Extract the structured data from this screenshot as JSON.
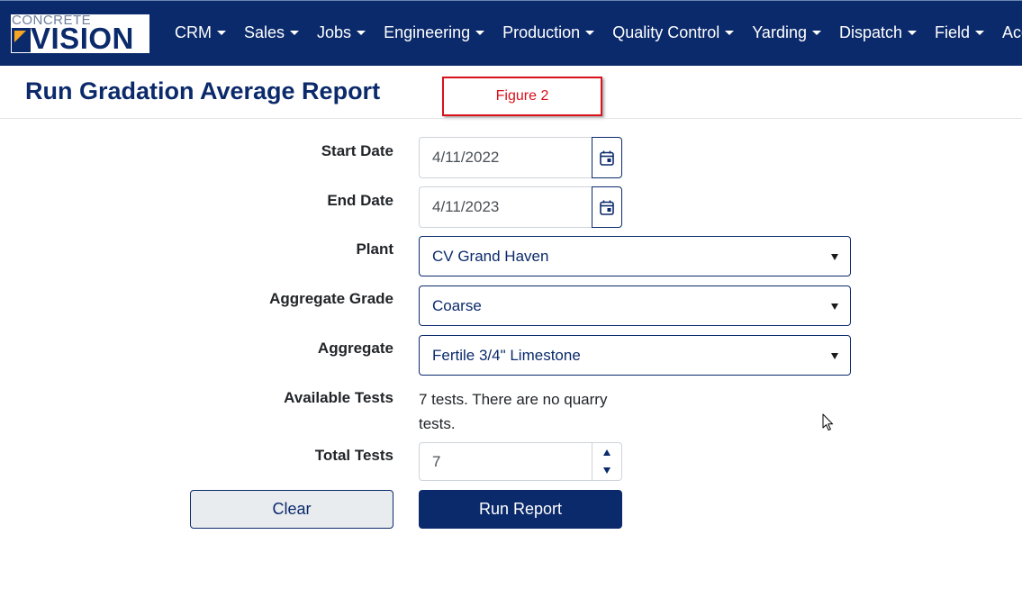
{
  "brand": {
    "logo_top": "CONCRETE",
    "logo_bottom": "VISION"
  },
  "nav": {
    "items": [
      {
        "label": "CRM"
      },
      {
        "label": "Sales"
      },
      {
        "label": "Jobs"
      },
      {
        "label": "Engineering"
      },
      {
        "label": "Production"
      },
      {
        "label": "Quality Control"
      },
      {
        "label": "Yarding"
      },
      {
        "label": "Dispatch"
      },
      {
        "label": "Field"
      },
      {
        "label": "Accou"
      }
    ]
  },
  "page": {
    "title": "Run Gradation Average Report",
    "figure_label": "Figure 2"
  },
  "form": {
    "start_date": {
      "label": "Start Date",
      "value": "4/11/2022",
      "icon": "calendar-icon"
    },
    "end_date": {
      "label": "End Date",
      "value": "4/11/2023",
      "icon": "calendar-icon"
    },
    "plant": {
      "label": "Plant",
      "value": "CV Grand Haven"
    },
    "aggregate_grade": {
      "label": "Aggregate Grade",
      "value": "Coarse"
    },
    "aggregate": {
      "label": "Aggregate",
      "value": "Fertile 3/4\" Limestone"
    },
    "available_tests": {
      "label": "Available Tests",
      "value": "7 tests. There are no quarry tests."
    },
    "total_tests": {
      "label": "Total Tests",
      "value": "7"
    }
  },
  "buttons": {
    "clear": "Clear",
    "run": "Run Report"
  },
  "colors": {
    "brand_navy": "#0b2a6b",
    "accent_orange": "#f6a623",
    "annotation_red": "#d9121b"
  }
}
